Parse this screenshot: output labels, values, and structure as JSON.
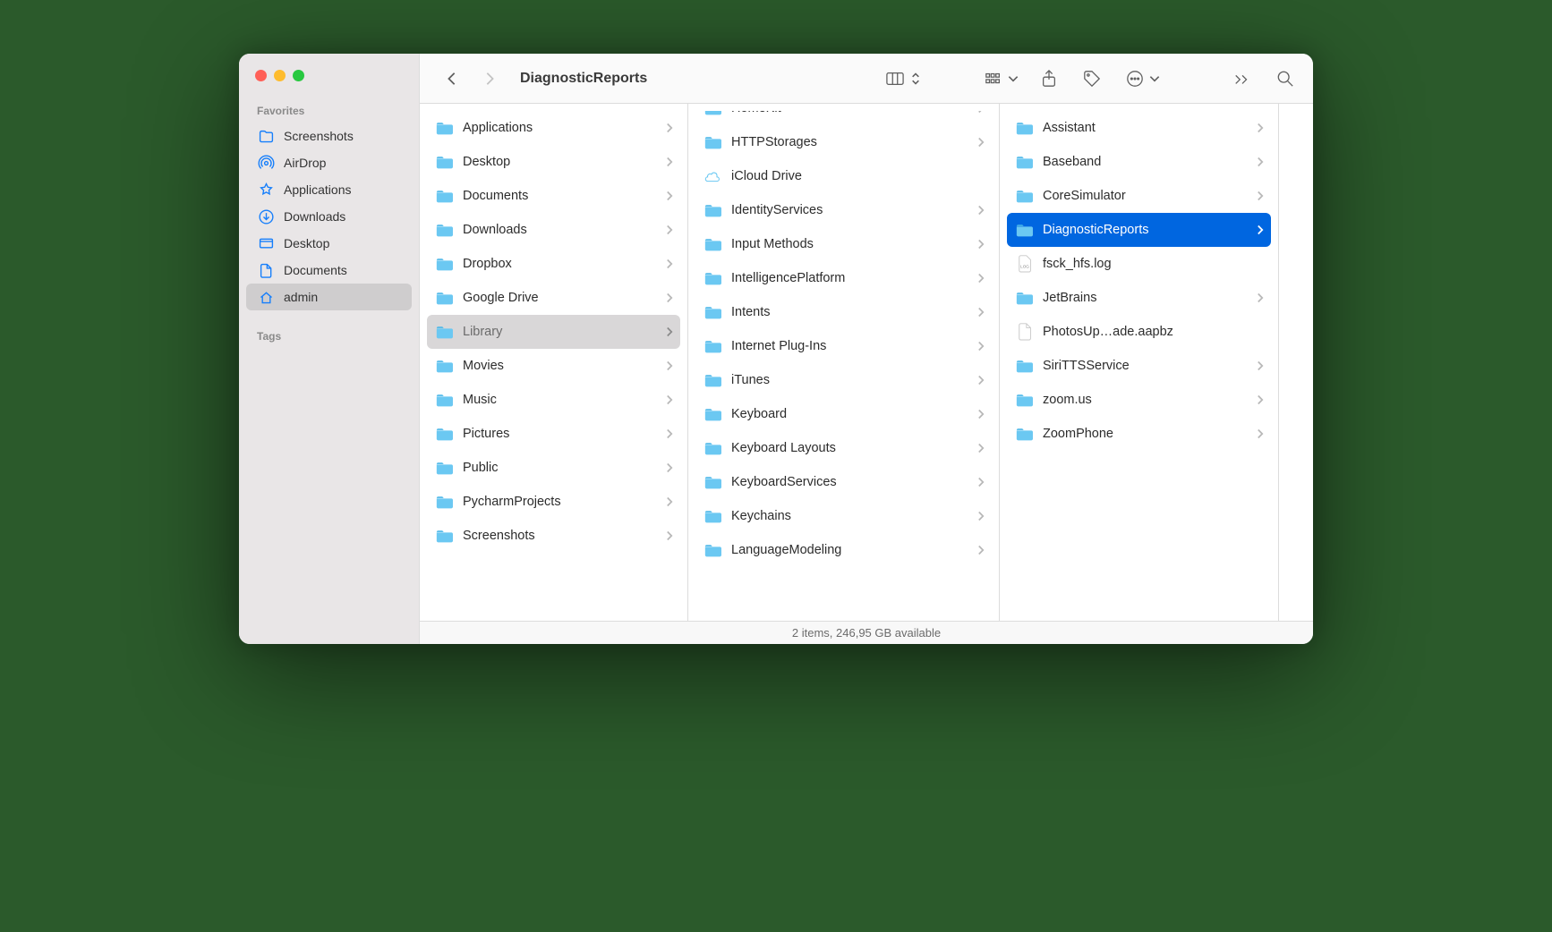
{
  "window": {
    "title": "DiagnosticReports"
  },
  "sidebar": {
    "sections": [
      {
        "heading": "Favorites",
        "items": [
          {
            "label": "Screenshots",
            "icon": "folder"
          },
          {
            "label": "AirDrop",
            "icon": "airdrop"
          },
          {
            "label": "Applications",
            "icon": "apps"
          },
          {
            "label": "Downloads",
            "icon": "download"
          },
          {
            "label": "Desktop",
            "icon": "desktop"
          },
          {
            "label": "Documents",
            "icon": "document"
          },
          {
            "label": "admin",
            "icon": "home",
            "selected": true
          }
        ]
      },
      {
        "heading": "Tags",
        "items": []
      }
    ]
  },
  "columns": [
    {
      "width_class": "c1",
      "items": [
        {
          "label": "Applications",
          "kind": "folder",
          "has_children": true
        },
        {
          "label": "Desktop",
          "kind": "folder",
          "has_children": true
        },
        {
          "label": "Documents",
          "kind": "folder",
          "has_children": true
        },
        {
          "label": "Downloads",
          "kind": "folder",
          "has_children": true
        },
        {
          "label": "Dropbox",
          "kind": "folder",
          "has_children": true
        },
        {
          "label": "Google Drive",
          "kind": "folder",
          "has_children": true
        },
        {
          "label": "Library",
          "kind": "folder",
          "has_children": true,
          "path_selected": true
        },
        {
          "label": "Movies",
          "kind": "folder",
          "has_children": true
        },
        {
          "label": "Music",
          "kind": "folder",
          "has_children": true
        },
        {
          "label": "Pictures",
          "kind": "folder",
          "has_children": true
        },
        {
          "label": "Public",
          "kind": "folder",
          "has_children": true
        },
        {
          "label": "PycharmProjects",
          "kind": "folder",
          "has_children": true
        },
        {
          "label": "Screenshots",
          "kind": "folder",
          "has_children": true
        }
      ]
    },
    {
      "width_class": "c2",
      "items": [
        {
          "label": "HomeKit",
          "kind": "folder",
          "has_children": true,
          "cut": true
        },
        {
          "label": "HTTPStorages",
          "kind": "folder",
          "has_children": true
        },
        {
          "label": "iCloud Drive",
          "kind": "cloud",
          "has_children": false
        },
        {
          "label": "IdentityServices",
          "kind": "folder",
          "has_children": true
        },
        {
          "label": "Input Methods",
          "kind": "folder",
          "has_children": true
        },
        {
          "label": "IntelligencePlatform",
          "kind": "folder",
          "has_children": true
        },
        {
          "label": "Intents",
          "kind": "folder",
          "has_children": true
        },
        {
          "label": "Internet Plug-Ins",
          "kind": "folder",
          "has_children": true
        },
        {
          "label": "iTunes",
          "kind": "folder",
          "has_children": true
        },
        {
          "label": "Keyboard",
          "kind": "folder",
          "has_children": true
        },
        {
          "label": "Keyboard Layouts",
          "kind": "folder",
          "has_children": true
        },
        {
          "label": "KeyboardServices",
          "kind": "folder",
          "has_children": true
        },
        {
          "label": "Keychains",
          "kind": "folder",
          "has_children": true
        },
        {
          "label": "LanguageModeling",
          "kind": "folder",
          "has_children": true
        }
      ]
    },
    {
      "width_class": "c3",
      "items": [
        {
          "label": "Assistant",
          "kind": "folder",
          "has_children": true
        },
        {
          "label": "Baseband",
          "kind": "folder",
          "has_children": true
        },
        {
          "label": "CoreSimulator",
          "kind": "folder",
          "has_children": true
        },
        {
          "label": "DiagnosticReports",
          "kind": "folder",
          "has_children": true,
          "active_selected": true
        },
        {
          "label": "fsck_hfs.log",
          "kind": "logfile",
          "has_children": false
        },
        {
          "label": "JetBrains",
          "kind": "folder",
          "has_children": true
        },
        {
          "label": "PhotosUp…ade.aapbz",
          "kind": "file",
          "has_children": false
        },
        {
          "label": "SiriTTSService",
          "kind": "folder",
          "has_children": true
        },
        {
          "label": "zoom.us",
          "kind": "folder",
          "has_children": true
        },
        {
          "label": "ZoomPhone",
          "kind": "folder",
          "has_children": true
        }
      ]
    },
    {
      "width_class": "c4",
      "items": []
    }
  ],
  "status": {
    "text": "2 items, 246,95 GB available"
  }
}
